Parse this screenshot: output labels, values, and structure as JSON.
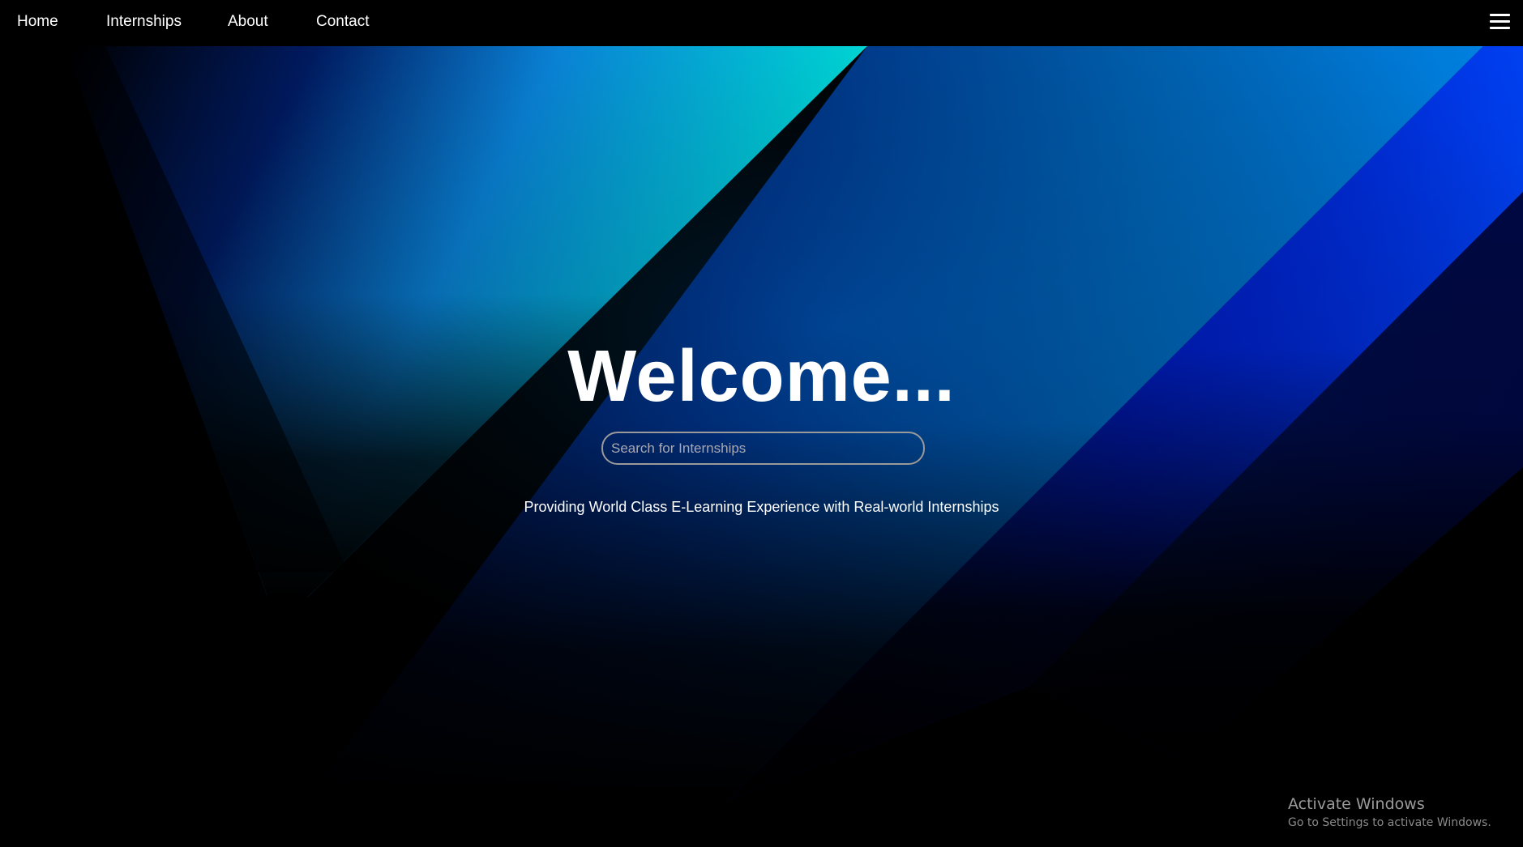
{
  "nav": {
    "items": [
      {
        "label": "Home"
      },
      {
        "label": "Internships"
      },
      {
        "label": "About"
      },
      {
        "label": "Contact"
      }
    ],
    "menu_icon": "hamburger-menu-icon"
  },
  "hero": {
    "title": "Welcome...",
    "search": {
      "placeholder": "Search for Internships",
      "value": ""
    },
    "tagline": "Providing World Class E-Learning Experience with Real-world Internships"
  },
  "watermark": {
    "title": "Activate Windows",
    "subtitle": "Go to Settings to activate Windows."
  },
  "colors": {
    "background": "#000000",
    "accent_cyan": "#00ffe0",
    "accent_blue": "#008ee0",
    "deep_blue": "#0010d0",
    "navy": "#000a60"
  }
}
